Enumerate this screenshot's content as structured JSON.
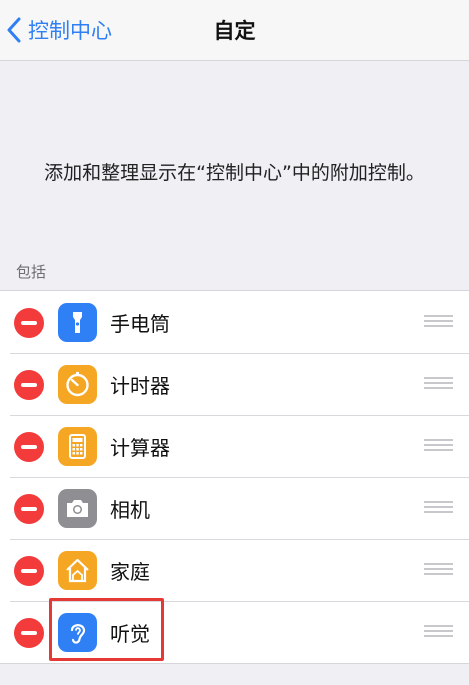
{
  "navbar": {
    "back_label": "控制中心",
    "title": "自定"
  },
  "description": "添加和整理显示在“控制中心”中的附加控制。",
  "section_header": "包括",
  "items": [
    {
      "label": "手电筒",
      "icon": "flashlight-icon",
      "color": "#2f7ff5"
    },
    {
      "label": "计时器",
      "icon": "timer-icon",
      "color": "#f5a623"
    },
    {
      "label": "计算器",
      "icon": "calculator-icon",
      "color": "#f5a623"
    },
    {
      "label": "相机",
      "icon": "camera-icon",
      "color": "#8e8e93"
    },
    {
      "label": "家庭",
      "icon": "home-icon",
      "color": "#f5a623"
    },
    {
      "label": "听觉",
      "icon": "ear-icon",
      "color": "#2f7ff5"
    }
  ],
  "colors": {
    "accent": "#2f7ff5",
    "remove": "#f43b3b",
    "highlight": "#e53935"
  }
}
